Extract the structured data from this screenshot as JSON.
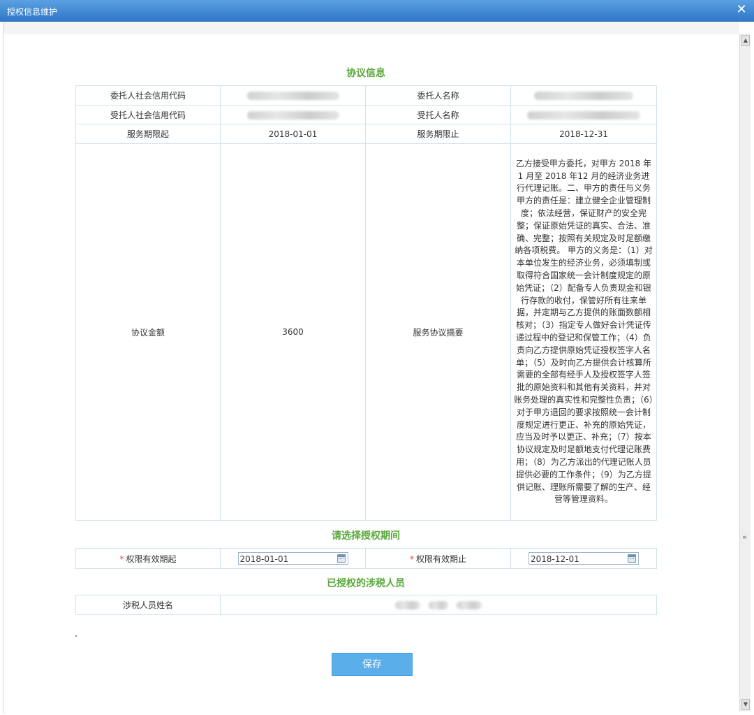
{
  "window": {
    "title": "授权信息维护",
    "close_symbol": "✕"
  },
  "agreement": {
    "section_title": "协议信息",
    "rows": {
      "principal_code_label": "委托人社会信用代码",
      "principal_name_label": "委托人名称",
      "agent_code_label": "受托人社会信用代码",
      "agent_name_label": "受托人名称",
      "service_start_label": "服务期限起",
      "service_start_value": "2018-01-01",
      "service_end_label": "服务期限止",
      "service_end_value": "2018-12-31",
      "amount_label": "协议金额",
      "amount_value": "3600",
      "summary_label": "服务协议摘要",
      "summary_value": "乙方接受甲方委托，对甲方 2018 年 1 月至 2018 年12 月的经济业务进行代理记账。二、甲方的责任与义务 甲方的责任是：建立健全企业管理制度；依法经营，保证财产的安全完整；保证原始凭证的真实、合法、准确、完整；按照有关规定及时足额缴纳各项税费。 甲方的义务是：（1）对本单位发生的经济业务，必须填制或取得符合国家统一会计制度规定的原始凭证；（2）配备专人负责现金和银行存款的收付，保管好所有往来单据，并定期与乙方提供的账面数额相核对；（3）指定专人做好会计凭证传递过程中的登记和保管工作；（4）负责向乙方提供原始凭证授权签字人名单；（5）及时向乙方提供会计核算所需要的全部有经手人及授权签字人签批的原始资料和其他有关资料，并对账务处理的真实性和完整性负责；（6）对于甲方退回的要求按照统一会计制度规定进行更正、补充的原始凭证，应当及时予以更正、补充；（7）按本协议规定及时足额地支付代理记账费用；（8）为乙方派出的代理记账人员提供必要的工作条件；（9）为乙方提供记账、理账所需要了解的生产、经营等管理资料。"
    }
  },
  "period": {
    "section_title": "请选择授权期间",
    "required_mark": "*",
    "start_label": "权限有效期起",
    "start_value": "2018-01-01",
    "end_label": "权限有效期止",
    "end_value": "2018-12-01"
  },
  "staff": {
    "section_title": "已授权的涉税人员",
    "name_label": "涉税人员姓名"
  },
  "actions": {
    "save_label": "保存"
  },
  "icons": {
    "close": "close-icon",
    "calendar": "calendar-icon"
  },
  "colors": {
    "titlebar": "#2f78c8",
    "section_title": "#58a83a",
    "button": "#5aaeea",
    "border": "#cfe4ea",
    "required": "#e23a3a"
  }
}
